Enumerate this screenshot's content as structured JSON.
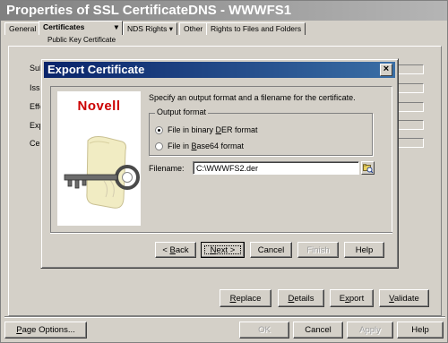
{
  "window": {
    "title": "Properties of SSL CertificateDNS - WWWFS1",
    "tabs": [
      "General",
      "Certificates",
      "NDS Rights",
      "Other",
      "Rights to Files and Folders"
    ],
    "active_tab": "Certificates",
    "subtab": "Public Key Certificate",
    "field_labels": [
      "Sub",
      "Issu",
      "Effe",
      "Exp",
      "Cer"
    ],
    "buttons": {
      "replace": "Replace",
      "details": "Details",
      "export": "Export",
      "validate": "Validate"
    },
    "footer": {
      "page_options": "Page Options...",
      "ok": "OK",
      "cancel": "Cancel",
      "apply": "Apply",
      "help": "Help"
    }
  },
  "dialog": {
    "title": "Export Certificate",
    "close": "×",
    "brand": "Novell",
    "instruction": "Specify an output format and a filename for the certificate.",
    "group_label": "Output format",
    "options": [
      {
        "label": "File in binary DER format",
        "selected": true
      },
      {
        "label": "File in Base64 format",
        "selected": false
      }
    ],
    "filename_label": "Filename:",
    "filename_value": "C:\\WWWFS2.der",
    "browse_icon": "folder-browse-icon",
    "buttons": {
      "back": "< Back",
      "next": "Next >",
      "cancel": "Cancel",
      "finish": "Finish",
      "help": "Help"
    }
  }
}
